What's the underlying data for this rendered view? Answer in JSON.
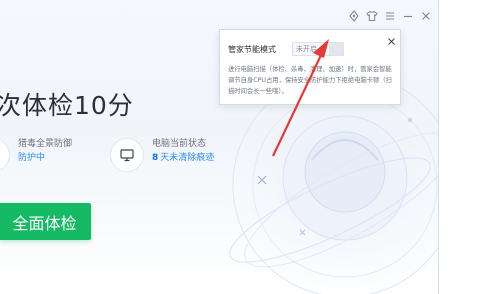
{
  "window": {
    "controls": [
      {
        "name": "skin-icon"
      },
      {
        "name": "shirt-icon"
      },
      {
        "name": "menu-icon"
      },
      {
        "name": "minimize-icon"
      },
      {
        "name": "close-icon"
      }
    ]
  },
  "main": {
    "headline": "次体检10分",
    "info": [
      {
        "icon": "shield-icon",
        "label": "猎毒全景防御",
        "value": "防护中"
      },
      {
        "icon": "monitor-icon",
        "label": "电脑当前状态",
        "value_num": "8",
        "value": "天未清除痕迹"
      }
    ],
    "scan_button": "全面体检"
  },
  "popup": {
    "title": "管家节能模式",
    "toggle_state": "未开启",
    "description": "进行电脑扫描（体检、杀毒、清理、加速）时，管家会智能调节自身CPU占用，保持安全防护能力下拒绝电脑卡顿（扫描时间会长一些哦）。"
  },
  "colors": {
    "accent_green": "#16b964",
    "status_blue": "#2d8cf0",
    "annotation_red": "#e53935"
  }
}
